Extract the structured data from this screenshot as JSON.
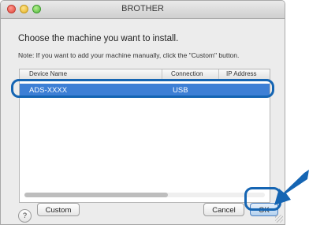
{
  "window": {
    "title": "BROTHER"
  },
  "dialog": {
    "heading": "Choose the machine you want to install.",
    "note": "Note: If you want to add your machine manually, click the \"Custom\" button."
  },
  "table": {
    "columns": [
      "Device Name",
      "Connection",
      "IP Address"
    ],
    "rows": [
      {
        "device": "ADS-XXXX",
        "connection": "USB"
      }
    ]
  },
  "buttons": {
    "help": "?",
    "custom": "Custom",
    "cancel": "Cancel",
    "ok": "OK"
  },
  "colors": {
    "selection": "#3d7fd5",
    "callout": "#1565b3"
  }
}
